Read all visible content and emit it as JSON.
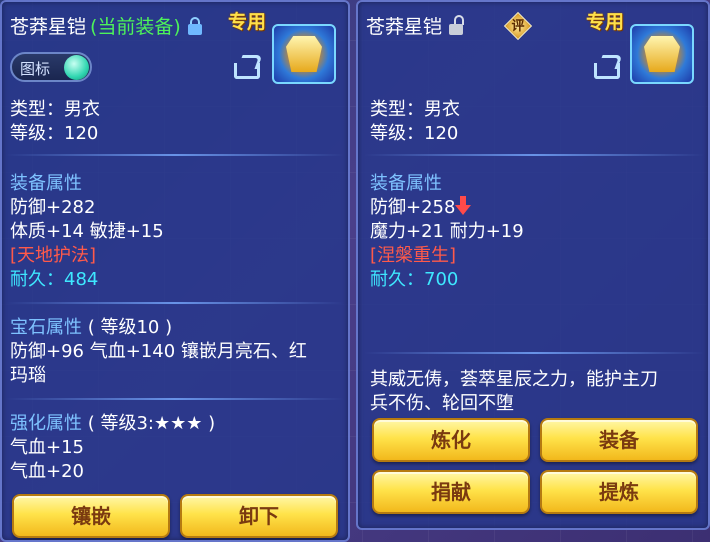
{
  "left": {
    "item_name": "苍莽星铠",
    "equipped_tag": "(当前装备)",
    "exclusive": "专用",
    "toggle_label": "图标",
    "type_line": "类型：男衣",
    "level_line": "等级：120",
    "equip_attr_title": "装备属性",
    "defense": "防御+282",
    "stats": "体质+14 敏捷+15",
    "special": "[天地护法]",
    "durability_label": "耐久：",
    "durability_value": "484",
    "gem_title": "宝石属性",
    "gem_level": "( 等级10 )",
    "gem_line1": "防御+96 气血+140 镶嵌月亮石、红",
    "gem_line2": "玛瑙",
    "enhance_title": "强化属性",
    "enhance_level": "( 等级3:★★★ )",
    "enhance_line1": "气血+15",
    "enhance_line2": "气血+20",
    "buttons": [
      "镶嵌",
      "卸下"
    ]
  },
  "right": {
    "item_name": "苍莽星铠",
    "review_char": "评",
    "exclusive": "专用",
    "type_line": "类型：男衣",
    "level_line": "等级：120",
    "equip_attr_title": "装备属性",
    "defense": "防御+258",
    "stats": "魔力+21 耐力+19",
    "special": "[涅槃重生]",
    "durability_label": "耐久：",
    "durability_value": "700",
    "description_line1": "其威无俦，荟萃星辰之力，能护主刀",
    "description_line2": "兵不伤、轮回不堕",
    "buttons": [
      "炼化",
      "装备",
      "捐献",
      "提炼"
    ]
  }
}
